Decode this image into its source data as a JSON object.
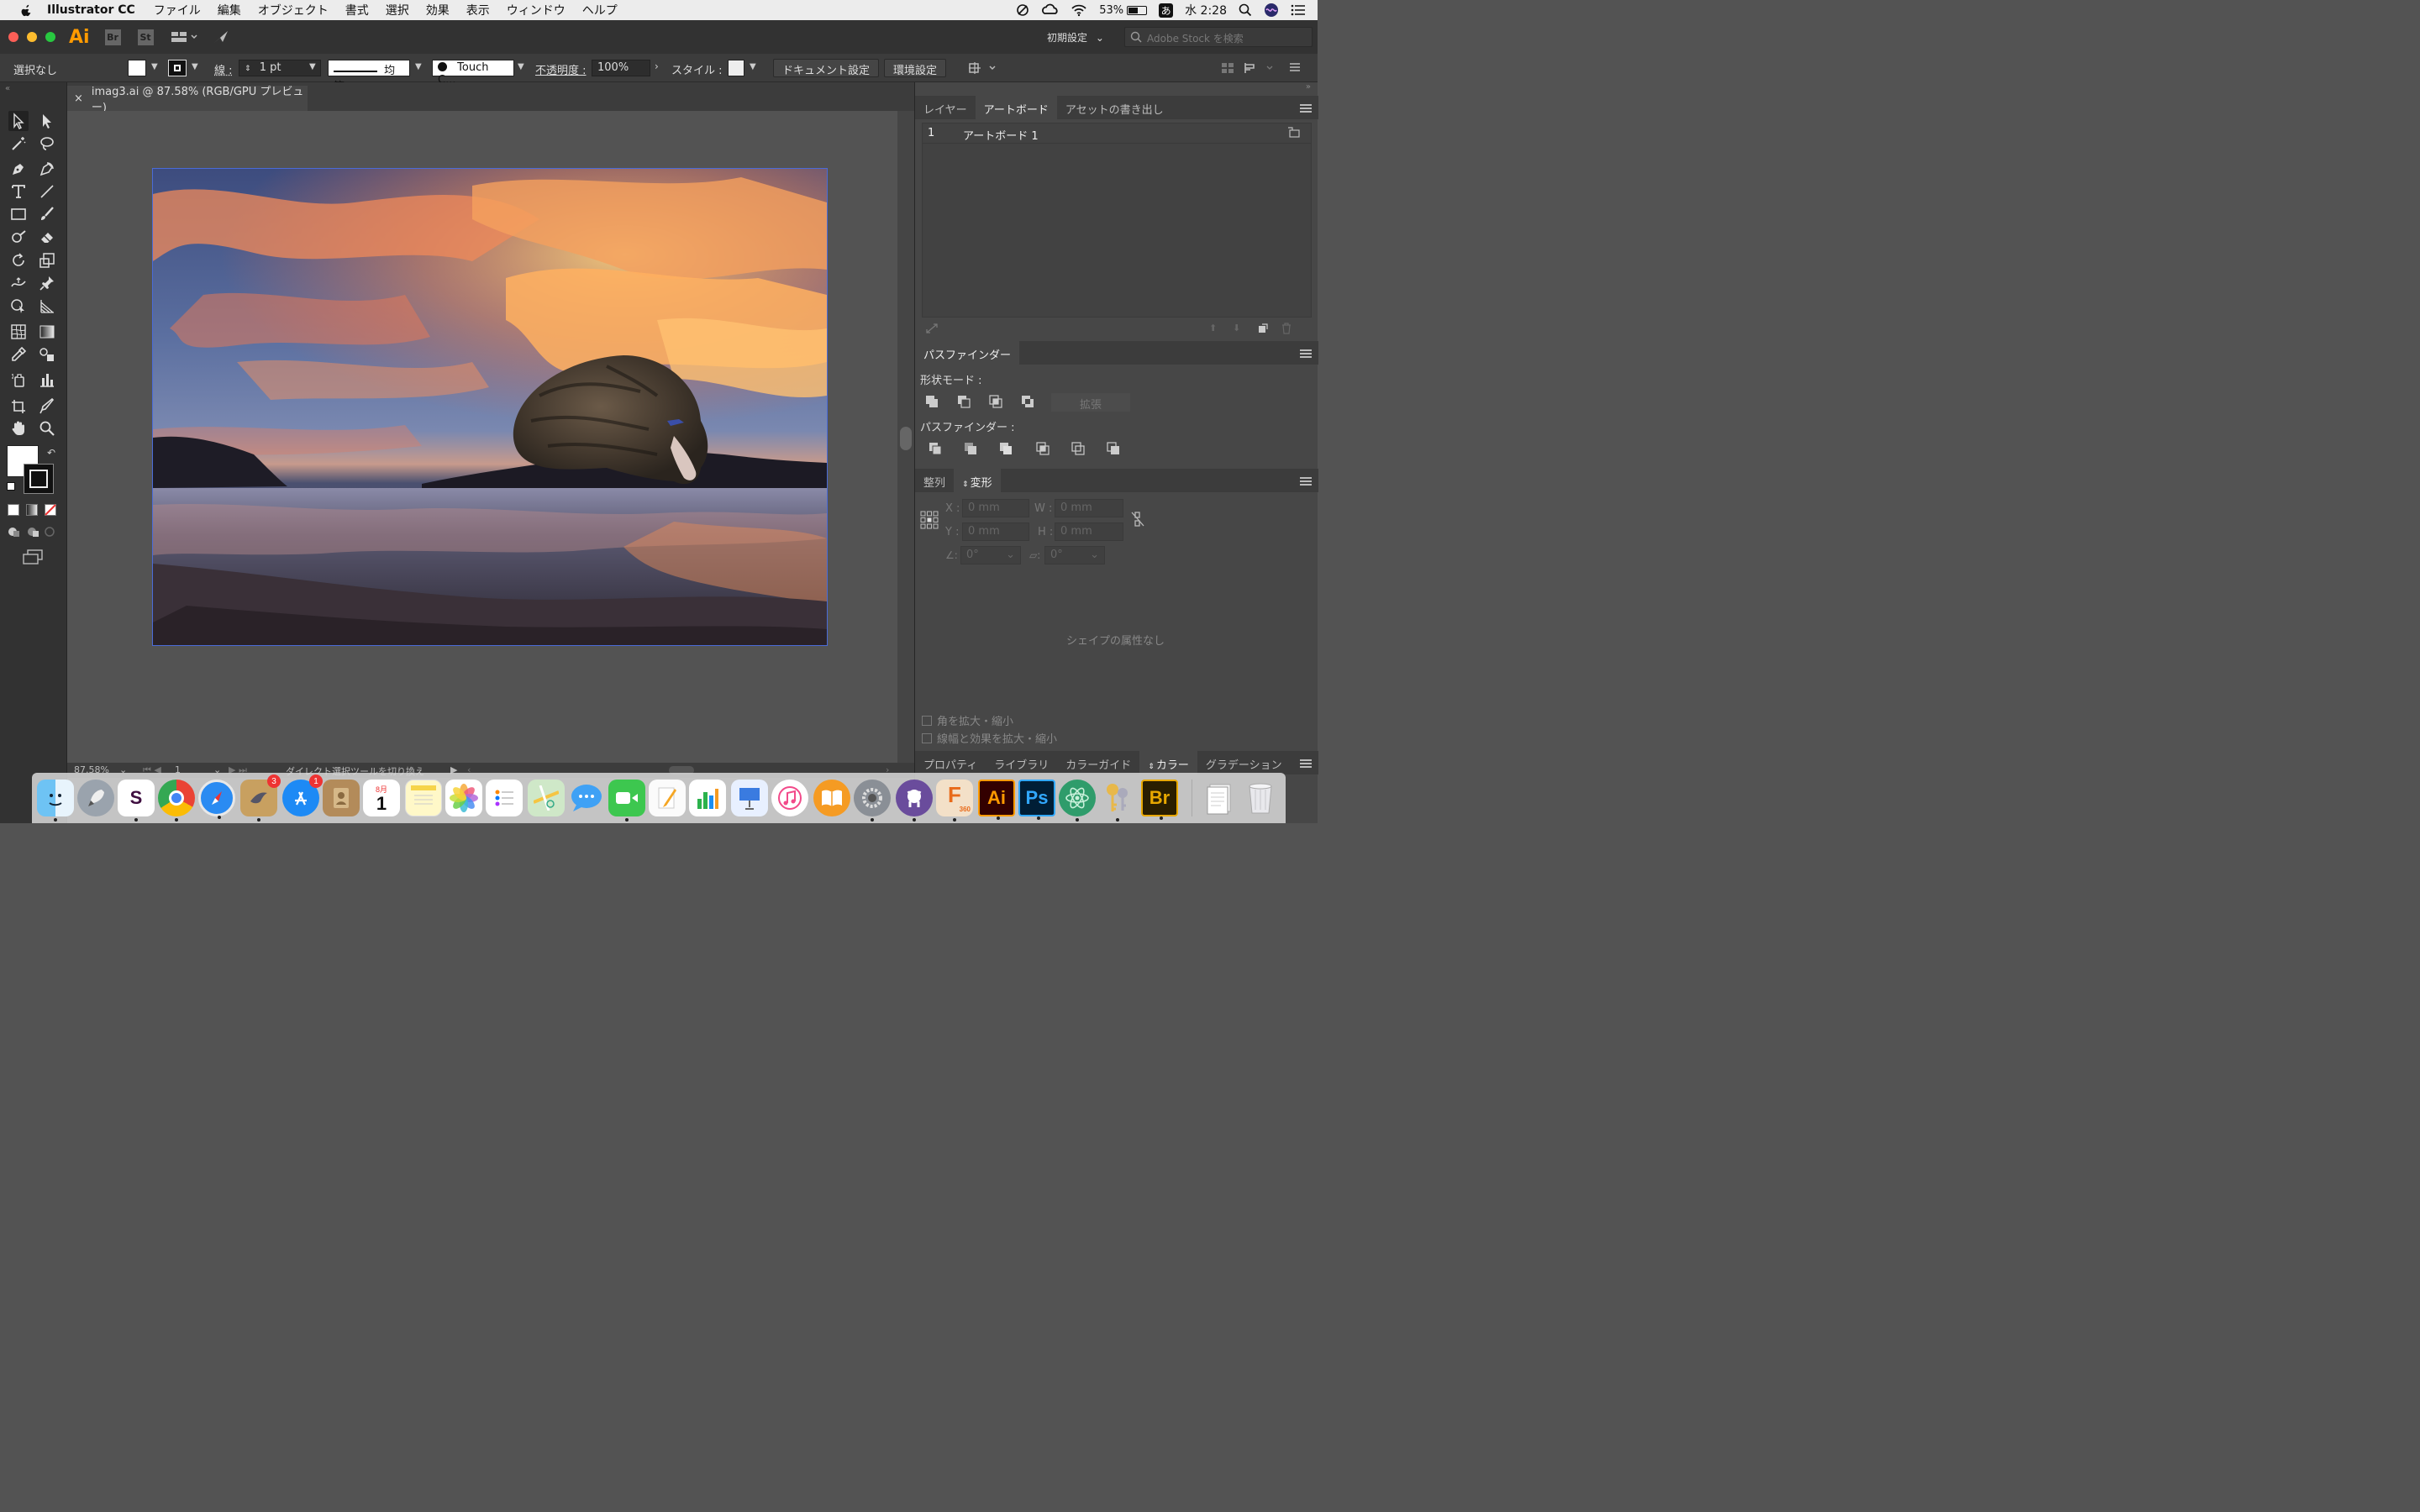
{
  "menubar": {
    "app_name": "Illustrator CC",
    "menus": [
      "ファイル",
      "編集",
      "オブジェクト",
      "書式",
      "選択",
      "効果",
      "表示",
      "ウィンドウ",
      "ヘルプ"
    ],
    "battery_percent": "53%",
    "battery_level": 0.53,
    "ime": "あ",
    "clock": "水 2:28"
  },
  "appbar": {
    "logo": "Ai",
    "bridge": "Br",
    "stock": "St",
    "workspace": "初期設定",
    "stock_search_placeholder": "Adobe Stock を検索"
  },
  "controlbar": {
    "selection": "選択なし",
    "stroke_label": "線 :",
    "stroke_weight": "1 pt",
    "stroke_profile": "均等",
    "brush": "Touch C...",
    "opacity_label": "不透明度 :",
    "opacity": "100%",
    "style_label": "スタイル :",
    "document_setup": "ドキュメント設定",
    "preferences": "環境設定"
  },
  "document": {
    "tab_title": "imag3.ai @ 87.58% (RGB/GPU プレビュー)",
    "close": "×"
  },
  "statusbar": {
    "zoom": "87.58%",
    "artboard_number": "1",
    "status_text": "ダイレクト選択ツールを切り換え"
  },
  "panels": {
    "top_tabs": [
      "レイヤー",
      "アートボード",
      "アセットの書き出し"
    ],
    "top_active": 1,
    "artboards": [
      {
        "index": "1",
        "name": "アートボード 1"
      }
    ],
    "pathfinder_tab": "パスファインダー",
    "shape_modes_label": "形状モード :",
    "expand_button": "拡張",
    "pathfinders_label": "パスファインダー :",
    "transform_tabs": [
      "整列",
      "変形"
    ],
    "transform_active": 1,
    "x_label": "X :",
    "y_label": "Y :",
    "w_label": "W :",
    "h_label": "H :",
    "x_value": "0 mm",
    "y_value": "0 mm",
    "w_value": "0 mm",
    "h_value": "0 mm",
    "angle_value": "0°",
    "shear_value": "0°",
    "no_shape": "シェイプの属性なし",
    "scale_corners": "角を拡大・縮小",
    "scale_strokes": "線幅と効果を拡大・縮小",
    "bottom_tabs": [
      "プロパティ",
      "ライブラリ",
      "カラーガイド",
      "カラー",
      "グラデーション"
    ],
    "bottom_active": 3
  },
  "dock": {
    "badges": {
      "photo_slideshow": "3",
      "app_store": "1"
    },
    "calendar_month": "8月",
    "calendar_day": "1",
    "icons": [
      "finder",
      "launchpad",
      "slack",
      "chrome",
      "safari",
      "photo-slideshow",
      "app-store",
      "contacts",
      "calendar",
      "notes",
      "photos",
      "reminders",
      "maps",
      "messages",
      "facetime",
      "pages",
      "numbers",
      "keynote",
      "itunes",
      "ibooks",
      "system-preferences",
      "github",
      "fusion-360",
      "illustrator",
      "photoshop",
      "atom",
      "keychain",
      "bridge",
      "documents",
      "trash"
    ],
    "labels": {
      "slack": "S",
      "illustrator": "Ai",
      "photoshop": "Ps",
      "bridge": "Br",
      "fusion": "F",
      "fusion_sub": "360"
    }
  },
  "colors": {
    "ui_dark": "#323232",
    "ui_mid": "#3c3c3c",
    "panel": "#474747",
    "canvas": "#535353",
    "artboard_border": "#4a6bd8",
    "ai_orange": "#ff9a00",
    "ps_blue": "#31a8ff"
  }
}
